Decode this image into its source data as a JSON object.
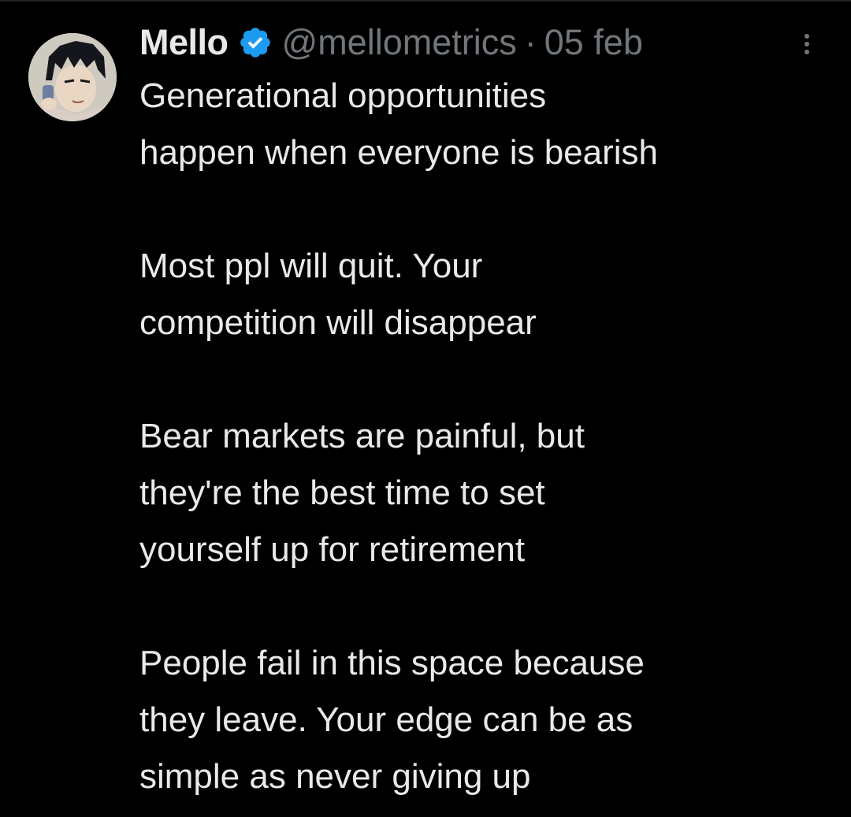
{
  "tweet": {
    "display_name": "Mello",
    "handle": "@mellometrics",
    "separator": "·",
    "date": "05 feb",
    "verified": true,
    "icons": {
      "verified": "verified-badge-icon",
      "more": "more-options-icon",
      "avatar": "profile-avatar"
    },
    "colors": {
      "background": "#000000",
      "text": "#e7e9ea",
      "secondary": "#71767b",
      "verified": "#1d9bf0"
    },
    "paragraphs": [
      {
        "lines": [
          "Generational opportunities",
          "happen when everyone is bearish"
        ]
      },
      {
        "lines": [
          "Most ppl will quit. Your",
          "competition will disappear"
        ]
      },
      {
        "lines": [
          "Bear markets are painful, but",
          "they're the best time to set",
          "yourself up for retirement"
        ]
      },
      {
        "lines": [
          "People fail in this space because",
          "they leave. Your edge can be as",
          "simple as never giving up"
        ]
      }
    ]
  }
}
